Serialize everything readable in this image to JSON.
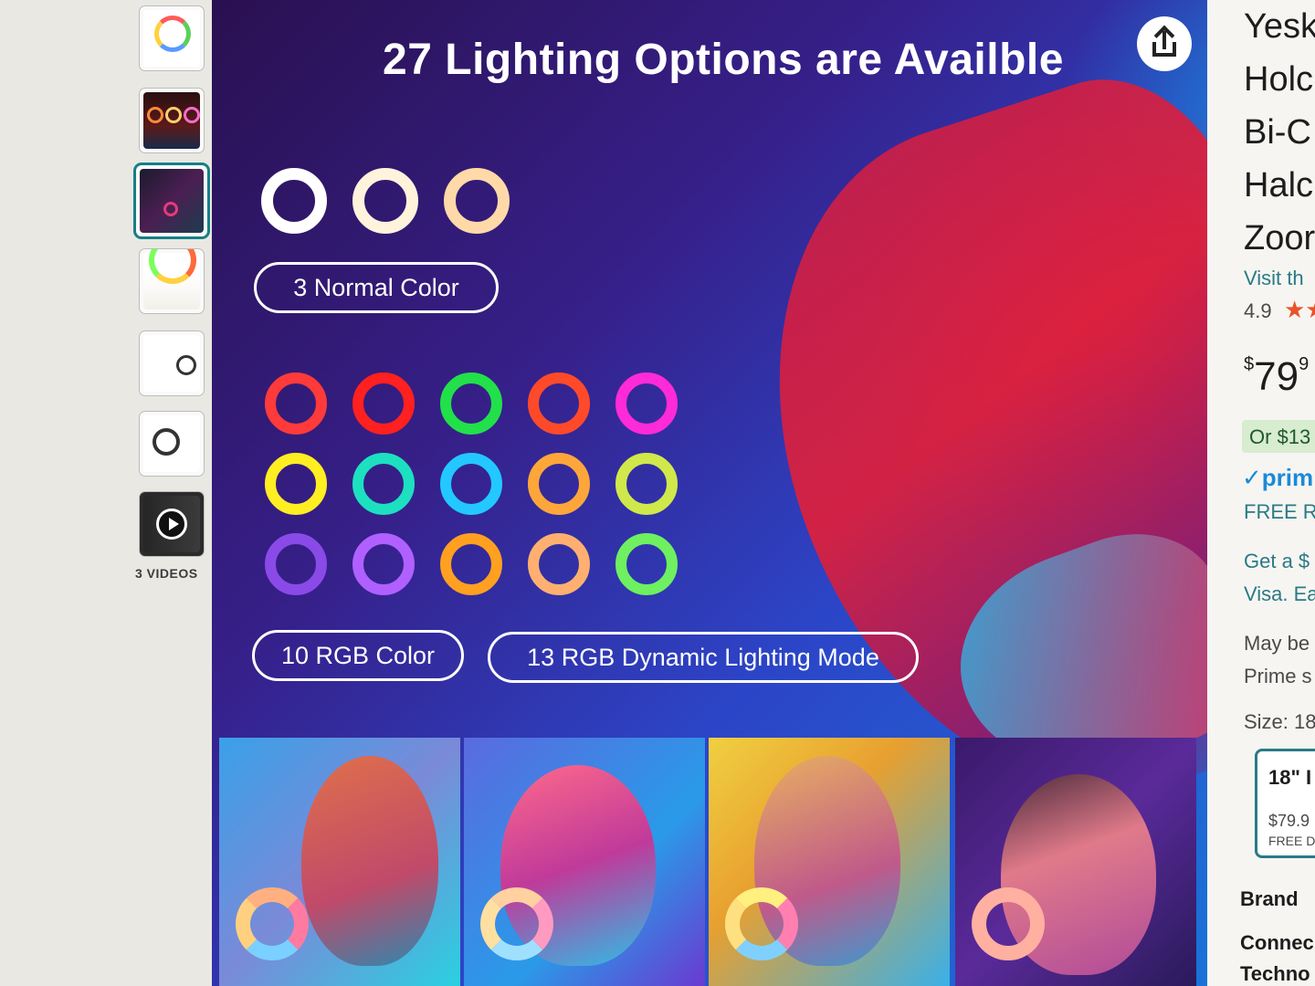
{
  "thumbnails": {
    "items": [
      {
        "name": "ring-light-kit"
      },
      {
        "name": "three-rgb-lights"
      },
      {
        "name": "lighting-options",
        "selected": true
      },
      {
        "name": "dimensions-diagram"
      },
      {
        "name": "tripod-setup"
      },
      {
        "name": "phone-holder"
      }
    ],
    "videos_label": "3 VIDEOS"
  },
  "main_image": {
    "title": "27 Lighting Options are Availble",
    "share_icon": "share-icon",
    "normal_label": "3 Normal Color",
    "rgb_label": "10 RGB Color",
    "dynamic_label": "13 RGB Dynamic Lighting Mode",
    "normal_rings": [
      "#ffffff",
      "#fff3dc",
      "#ffd9a8"
    ],
    "rgb_rings": [
      "#ff3a3a",
      "#ff2020",
      "#22e04a",
      "#ff4a2a",
      "#ff2ad8",
      "#ffee22",
      "#1de0c0",
      "#22c8ff",
      "#ffa63a",
      "#d0e84a",
      "#8a4ae8",
      "#b060ff",
      "#ffa020",
      "#ffb070",
      "#6ef060"
    ]
  },
  "product": {
    "title_lines": [
      "Yesk",
      "Holc",
      "Bi-C",
      "Halc",
      "Zoor"
    ],
    "store_link": "Visit th",
    "rating": "4.9",
    "stars": "★★",
    "price_symbol": "$",
    "price_whole": "79",
    "price_fraction": "9",
    "or_text": "Or $13",
    "prime_text": "✓prim",
    "free_text": "FREE R",
    "offer_line1": "Get a $",
    "offer_line2": "Visa. Ea",
    "may_line1": "May be",
    "may_line2": "Prime s",
    "size_label": "Size: 18",
    "size_option": "18\" I",
    "size_price": "$79.9",
    "size_free": "FREE D",
    "brand_label": "Brand",
    "conn_label": "Connec",
    "tech_label": "Techno"
  }
}
